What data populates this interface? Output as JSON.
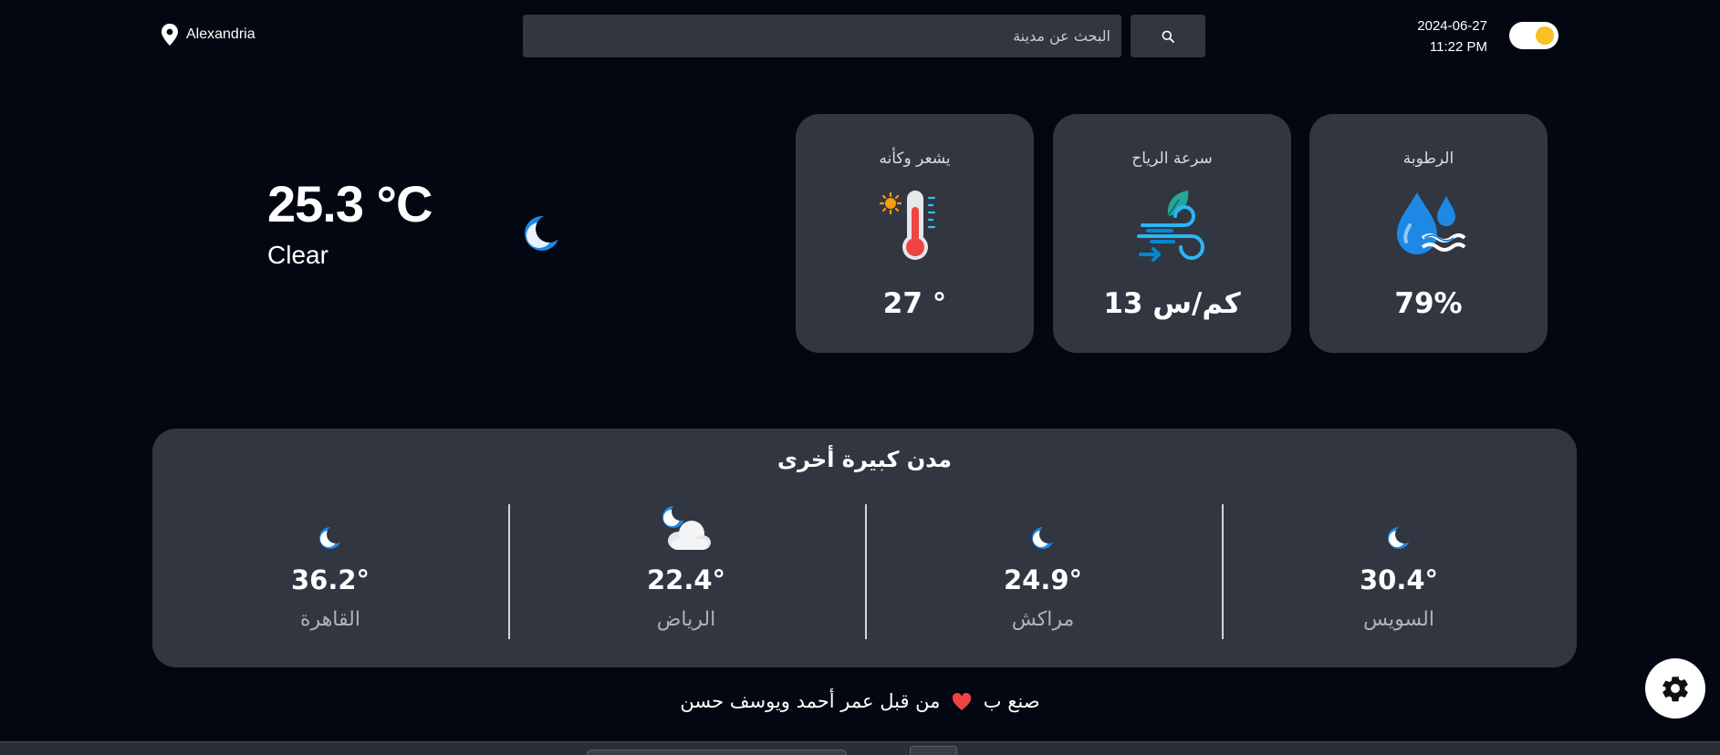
{
  "header": {
    "location": "Alexandria",
    "search_placeholder": "البحث عن مدينة",
    "date": "2024-06-27",
    "time": "11:22 PM",
    "theme_toggle_on": true
  },
  "current": {
    "temperature": "25.3 °C",
    "condition": "Clear",
    "icon": "moon-icon"
  },
  "stats": [
    {
      "title": "الرطوبة",
      "value": "79%",
      "icon": "humidity-icon"
    },
    {
      "title": "سرعة الرياح",
      "value": "13 كم/س",
      "icon": "wind-icon"
    },
    {
      "title": "يشعر وكأنه",
      "value": "27 °",
      "icon": "thermometer-icon"
    }
  ],
  "other_cities": {
    "heading": "مدن كبيرة أخرى",
    "cities": [
      {
        "name": "السويس",
        "temp": "30.4°",
        "icon": "moon-icon"
      },
      {
        "name": "مراكش",
        "temp": "24.9°",
        "icon": "moon-icon"
      },
      {
        "name": "الرياض",
        "temp": "22.4°",
        "icon": "cloudy-night-icon"
      },
      {
        "name": "القاهرة",
        "temp": "36.2°",
        "icon": "moon-icon"
      }
    ]
  },
  "footer": {
    "made_with": "صنع ب",
    "by": "من قبل عمر أحمد ويوسف حسن"
  },
  "colors": {
    "background": "#030712",
    "card": "#323640",
    "accent_yellow": "#fbbf24",
    "icon_blue": "#1e88e5"
  }
}
